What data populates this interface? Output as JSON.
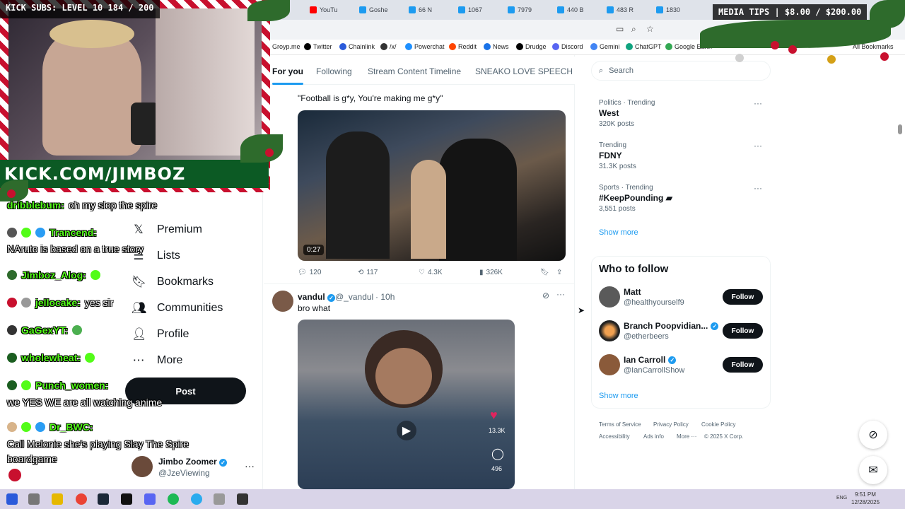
{
  "browser": {
    "tabs": [
      {
        "label": "YouTu",
        "color": "#ff0000"
      },
      {
        "label": "Goshe",
        "color": "#1d9bf0"
      },
      {
        "label": "66 N",
        "color": "#1d9bf0"
      },
      {
        "label": "1067",
        "color": "#1d9bf0"
      },
      {
        "label": "7979",
        "color": "#1d9bf0"
      },
      {
        "label": "440 B",
        "color": "#1d9bf0"
      },
      {
        "label": "483 R",
        "color": "#1d9bf0"
      },
      {
        "label": "1830",
        "color": "#1d9bf0"
      }
    ],
    "bookmarks": [
      {
        "label": "Groyp.me",
        "color": "#777777"
      },
      {
        "label": "Twitter",
        "color": "#000000"
      },
      {
        "label": "Chainlink",
        "color": "#2a5ada"
      },
      {
        "label": "/x/",
        "color": "#333333"
      },
      {
        "label": "Powerchat",
        "color": "#1e90ff"
      },
      {
        "label": "Reddit",
        "color": "#ff4500"
      },
      {
        "label": "News",
        "color": "#1a73e8"
      },
      {
        "label": "Drudge",
        "color": "#000000"
      },
      {
        "label": "Discord",
        "color": "#5865f2"
      },
      {
        "label": "Gemini",
        "color": "#4285f4"
      },
      {
        "label": "ChatGPT",
        "color": "#10a37f"
      },
      {
        "label": "Google Earth",
        "color": "#34a853"
      }
    ],
    "all_bookmarks": "All Bookmarks"
  },
  "stream": {
    "kick_subs": "KICK SUBS: LEVEL 10 184 / 200",
    "kick_url": "KICK.COM/JIMBOZ",
    "media_tips": "MEDIA TIPS | $8.00 / $200.00",
    "chat": [
      {
        "user": "dribblebum:",
        "msg": "oh my slop the spire"
      },
      {
        "user": "Trancend:",
        "msg": ""
      },
      {
        "user": "",
        "msg": "NAruto is based on a true story"
      },
      {
        "user": "Jimboz_Alog:",
        "msg": ""
      },
      {
        "user": "jellocake:",
        "msg": "yes sir"
      },
      {
        "user": "GaGexYT:",
        "msg": ""
      },
      {
        "user": "wholewheat:",
        "msg": ""
      },
      {
        "user": "Punch_women:",
        "msg": ""
      },
      {
        "user": "",
        "msg": "we YES WE are all watching anime"
      },
      {
        "user": "Dr_BWC:",
        "msg": ""
      },
      {
        "user": "",
        "msg": "Call Melonie she's playing Slay The Spire"
      },
      {
        "user": "",
        "msg": "boardgame"
      }
    ]
  },
  "nav": {
    "items": [
      {
        "label": "Premium",
        "icon": "x-logo-icon"
      },
      {
        "label": "Lists",
        "icon": "list-icon"
      },
      {
        "label": "Bookmarks",
        "icon": "bookmark-icon"
      },
      {
        "label": "Communities",
        "icon": "people-icon"
      },
      {
        "label": "Profile",
        "icon": "person-icon"
      },
      {
        "label": "More",
        "icon": "more-circle-icon"
      }
    ],
    "post": "Post",
    "account": {
      "name": "Jimbo Zoomer",
      "handle": "@JzeViewing"
    }
  },
  "feed": {
    "tabs": [
      "For you",
      "Following",
      "Stream Content Timeline",
      "SNEAKO LOVE SPEECH"
    ],
    "tweet1": {
      "text": "\"Football is g*y, You're making me g*y\"",
      "duration": "0:27",
      "replies": "120",
      "reposts": "117",
      "likes": "4.3K",
      "views": "326K"
    },
    "tweet2": {
      "name": "vandul",
      "handle": "@_vandul",
      "time": "10h",
      "text": "bro what",
      "likes": "13.3K",
      "comments": "496"
    }
  },
  "sidebar": {
    "search_placeholder": "Search",
    "trends": [
      {
        "meta": "Politics · Trending",
        "name": "West",
        "count": "320K posts"
      },
      {
        "meta": "Trending",
        "name": "FDNY",
        "count": "31.3K posts"
      },
      {
        "meta": "Sports · Trending",
        "name": "#KeepPounding",
        "count": "3,551 posts"
      }
    ],
    "show_more": "Show more",
    "who_to_follow": "Who to follow",
    "follow_suggestions": [
      {
        "name": "Matt",
        "handle": "@healthyourself9",
        "verified": false
      },
      {
        "name": "Branch Poopvidian...",
        "handle": "@etherbeers",
        "verified": true
      },
      {
        "name": "Ian Carroll",
        "handle": "@IanCarrollShow",
        "verified": true
      }
    ],
    "follow_label": "Follow",
    "show_more_2": "Show more",
    "footer": [
      "Terms of Service",
      "Privacy Policy",
      "Cookie Policy",
      "Accessibility",
      "Ads info",
      "More ···",
      "© 2025 X Corp."
    ]
  },
  "taskbar": {
    "lang": "ENG",
    "time": "9:51 PM",
    "date": "12/28/2025"
  }
}
